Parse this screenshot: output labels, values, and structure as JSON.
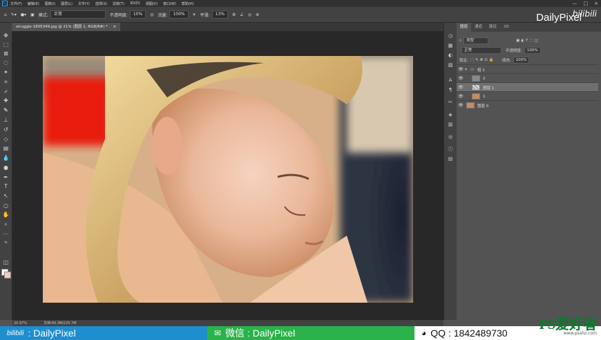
{
  "menubar": {
    "app_icon": "Ps",
    "items": [
      "文件(F)",
      "编辑(E)",
      "图像(I)",
      "图层(L)",
      "文字(Y)",
      "选择(S)",
      "滤镜(T)",
      "3D(D)",
      "视图(V)",
      "窗口(W)",
      "帮助(H)"
    ],
    "window_buttons": [
      "—",
      "□",
      "×"
    ]
  },
  "options": {
    "mode_label": "模式:",
    "mode_value": "正常",
    "opacity_label": "不透明度:",
    "opacity_value": "10%",
    "flow_label": "流量:",
    "flow_value": "100%",
    "smooth_label": "平滑:",
    "smooth_value": "13%"
  },
  "watermark": {
    "top_text": "DailyPixel",
    "bili_text": "bilibili"
  },
  "document": {
    "tab_title": "struggle-1805349.jpg @ 21% (图层 1, RGB/8#) *",
    "tab_close": "×"
  },
  "statusbar": {
    "zoom": "20.97%",
    "doc_info": "文档:60.3M/225.7M"
  },
  "panel": {
    "tabs": [
      "图层",
      "通道",
      "路径",
      "3D"
    ],
    "kind_label": "类型",
    "blend_mode": "正常",
    "opacity_label": "不透明度:",
    "opacity_value": "100%",
    "lock_label": "锁定:",
    "fill_label": "填充:",
    "fill_value": "100%",
    "layers": [
      {
        "name": "组 1",
        "type": "group"
      },
      {
        "name": "2",
        "type": "layer"
      },
      {
        "name": "图层 1",
        "type": "layer",
        "selected": true
      },
      {
        "name": "1",
        "type": "layer"
      },
      {
        "name": "图层 0",
        "type": "layer"
      }
    ]
  },
  "banner": {
    "bili_logo": "bilibili",
    "bili_text": ": DailyPixel",
    "wechat_text": "微信 : DailyPixel",
    "qq_text": "QQ : 1842489730",
    "site_logo": "PS爱好者",
    "site_url": "www.psahz.com"
  },
  "colors": {
    "foreground": "#ffffff",
    "background": "#f4c9bf",
    "bili_blue": "#1f8ecf",
    "wechat_green": "#29b34a"
  }
}
